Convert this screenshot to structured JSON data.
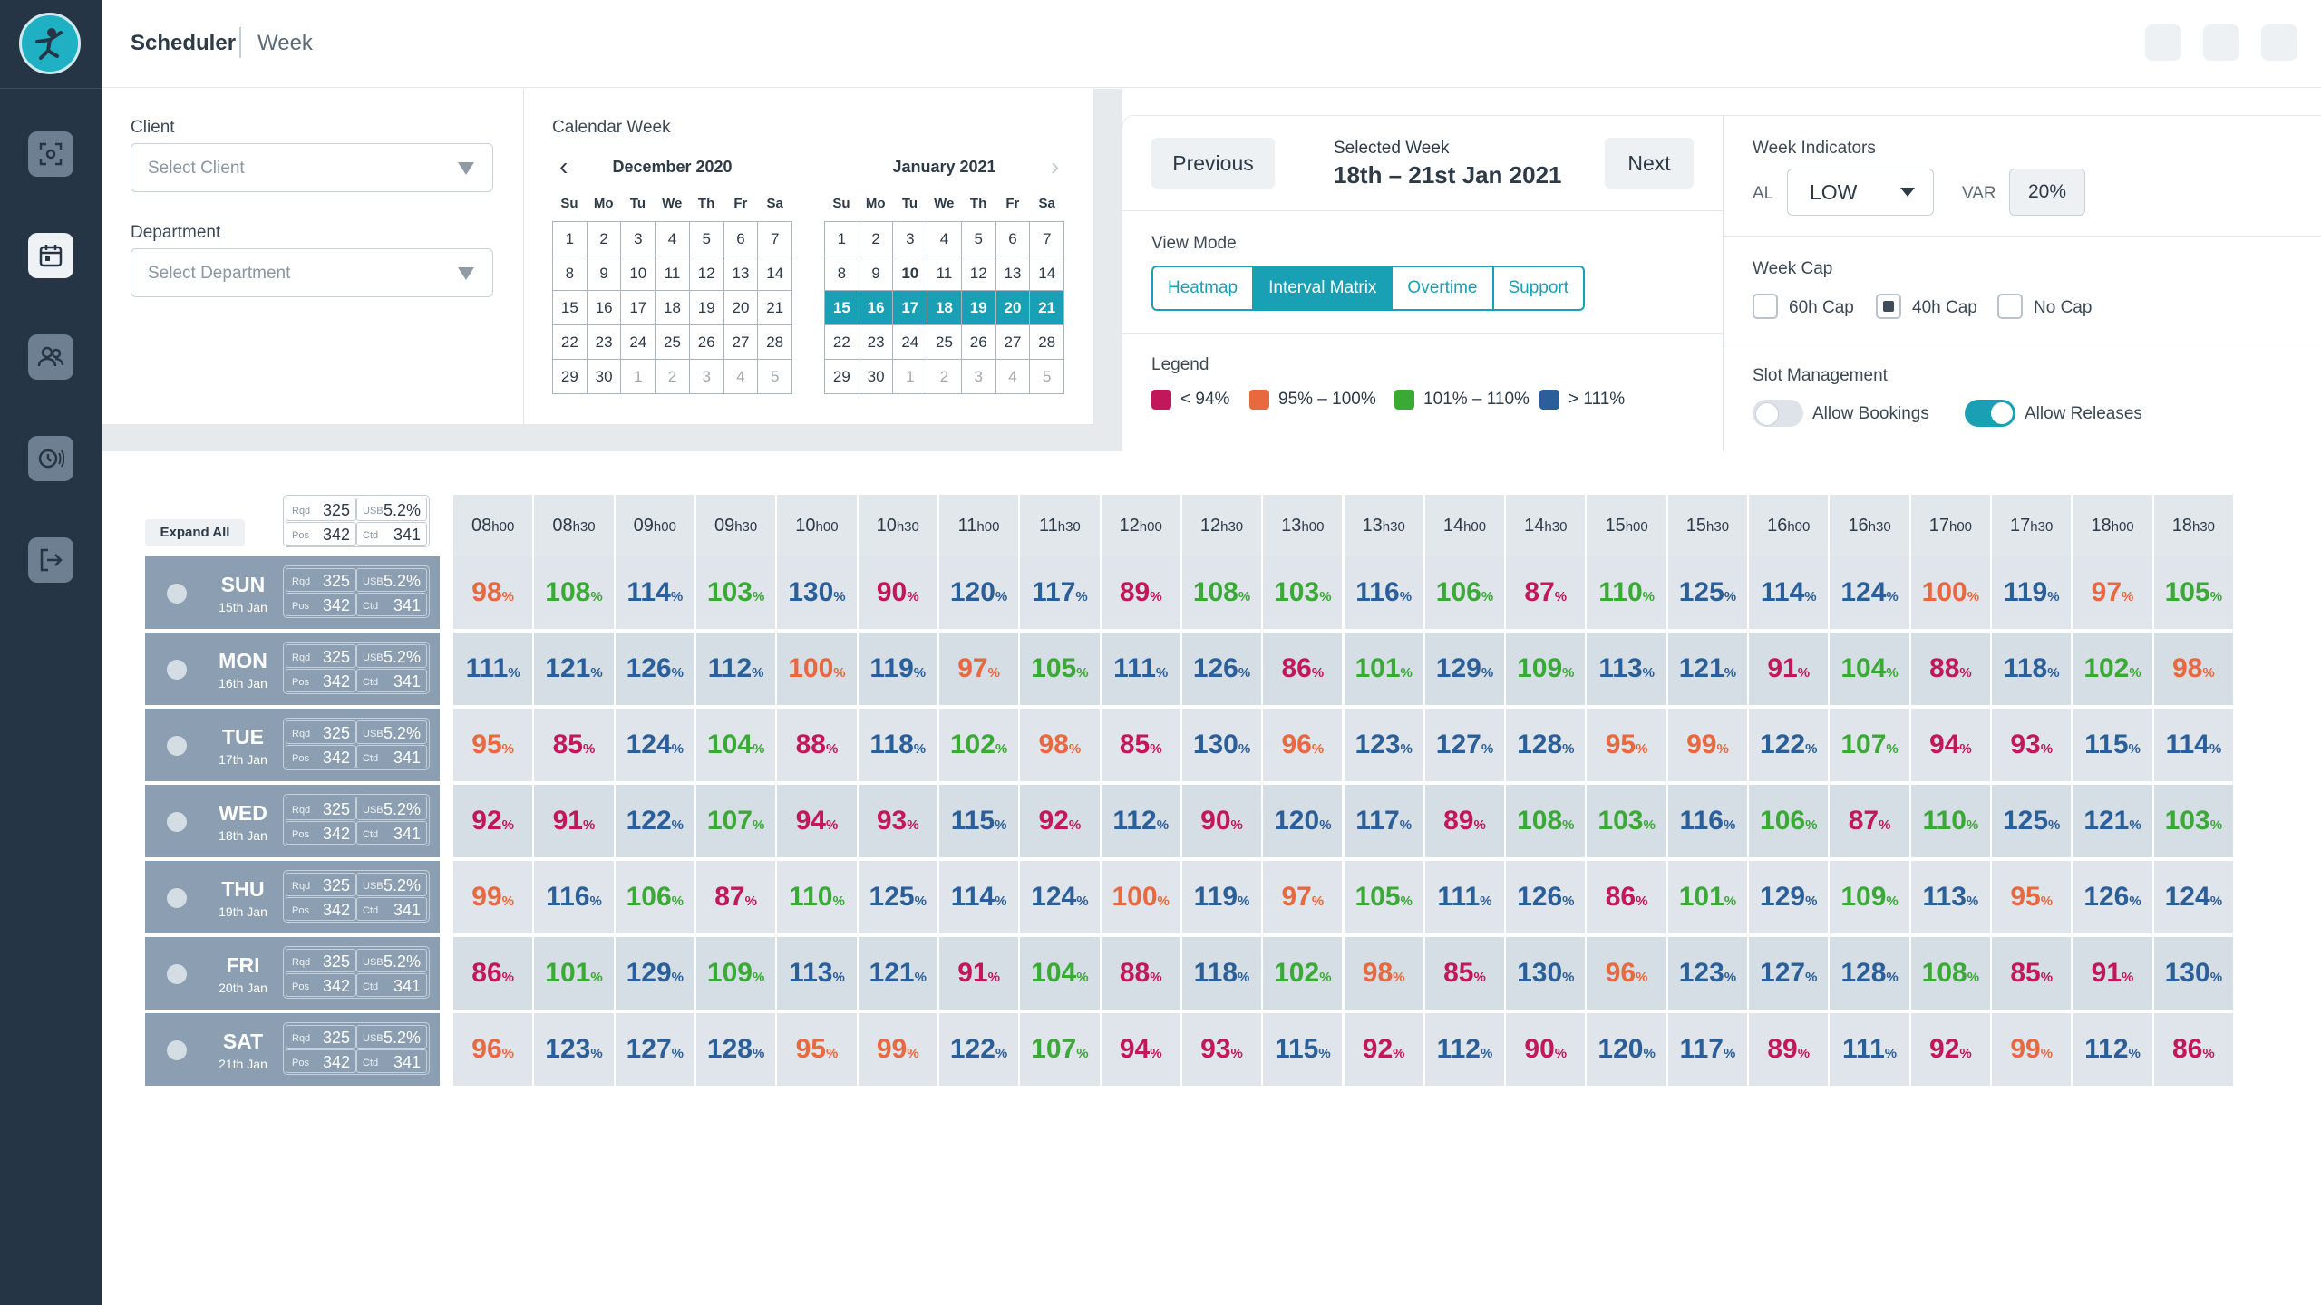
{
  "app": {
    "breadcrumb": [
      "Scheduler",
      "Week"
    ]
  },
  "nav": [
    "scan-icon",
    "calendar-icon",
    "users-icon",
    "clock-broadcast-icon",
    "exit-icon"
  ],
  "filters": {
    "client_label": "Client",
    "client_placeholder": "Select Client",
    "department_label": "Department",
    "department_placeholder": "Select Department",
    "calendar_label": "Calendar Week",
    "calendar_left": {
      "month": "December 2020"
    },
    "calendar_right": {
      "month": "January 2021"
    },
    "weekdays": [
      "Su",
      "Mo",
      "Tu",
      "We",
      "Th",
      "Fr",
      "Sa"
    ]
  },
  "week": {
    "previous_label": "Previous",
    "next_label": "Next",
    "selected_label": "Selected Week",
    "selected_value": "18th – 21st Jan 2021",
    "view_mode_label": "View Mode",
    "view_modes": [
      "Heatmap",
      "Interval Matrix",
      "Overtime",
      "Support"
    ],
    "view_mode_active": "Interval Matrix",
    "legend_label": "Legend",
    "legend": [
      {
        "label": "< 94%",
        "color": "#c2185b"
      },
      {
        "label": "95% – 100%",
        "color": "#e8683f"
      },
      {
        "label": "101% – 110%",
        "color": "#3aa935"
      },
      {
        "label": "> 111%",
        "color": "#2b5f99"
      }
    ]
  },
  "indicators": {
    "title": "Week Indicators",
    "al_label": "AL",
    "al_value": "LOW",
    "var_label": "VAR",
    "var_value": "20%",
    "cap_title": "Week Cap",
    "caps": [
      {
        "label": "60h Cap",
        "checked": false
      },
      {
        "label": "40h Cap",
        "checked": true
      },
      {
        "label": "No Cap",
        "checked": false
      }
    ],
    "slot_title": "Slot Management",
    "allow_bookings_label": "Allow Bookings",
    "allow_bookings": false,
    "allow_releases_label": "Allow Releases",
    "allow_releases": true
  },
  "matrix": {
    "expand_label": "Expand All",
    "summary": {
      "rqd_label": "Rqd",
      "rqd": "325",
      "usb_label": "USB",
      "usb": "5.2%",
      "pos_label": "Pos",
      "pos": "342",
      "ctd_label": "Ctd",
      "ctd": "341"
    },
    "times": [
      "08h00",
      "08h30",
      "09h00",
      "09h30",
      "10h00",
      "10h30",
      "11h00",
      "11h30",
      "12h00",
      "12h30",
      "13h00",
      "13h30",
      "14h00",
      "14h30",
      "15h00",
      "15h30",
      "16h00",
      "16h30",
      "17h00",
      "17h30",
      "18h00",
      "18h30"
    ],
    "rows": [
      {
        "day": "SUN",
        "date": "15th Jan",
        "rqd": "325",
        "usb": "5.2%",
        "pos": "342",
        "ctd": "341",
        "values": [
          98,
          108,
          114,
          103,
          130,
          90,
          120,
          117,
          89,
          108,
          103,
          116,
          106,
          87,
          110,
          125,
          114,
          124,
          100,
          119,
          97,
          105
        ]
      },
      {
        "day": "MON",
        "date": "16th Jan",
        "rqd": "325",
        "usb": "5.2%",
        "pos": "342",
        "ctd": "341",
        "values": [
          111,
          121,
          126,
          112,
          100,
          119,
          97,
          105,
          111,
          126,
          86,
          101,
          129,
          109,
          113,
          121,
          91,
          104,
          88,
          118,
          102,
          98
        ]
      },
      {
        "day": "TUE",
        "date": "17th Jan",
        "rqd": "325",
        "usb": "5.2%",
        "pos": "342",
        "ctd": "341",
        "values": [
          95,
          85,
          124,
          104,
          88,
          118,
          102,
          98,
          85,
          130,
          96,
          123,
          127,
          128,
          95,
          99,
          122,
          107,
          94,
          93,
          115,
          114
        ]
      },
      {
        "day": "WED",
        "date": "18th Jan",
        "rqd": "325",
        "usb": "5.2%",
        "pos": "342",
        "ctd": "341",
        "values": [
          92,
          91,
          122,
          107,
          94,
          93,
          115,
          92,
          112,
          90,
          120,
          117,
          89,
          108,
          103,
          116,
          106,
          87,
          110,
          125,
          121,
          103
        ]
      },
      {
        "day": "THU",
        "date": "19th Jan",
        "rqd": "325",
        "usb": "5.2%",
        "pos": "342",
        "ctd": "341",
        "values": [
          99,
          116,
          106,
          87,
          110,
          125,
          114,
          124,
          100,
          119,
          97,
          105,
          111,
          126,
          86,
          101,
          129,
          109,
          113,
          95,
          126,
          124
        ]
      },
      {
        "day": "FRI",
        "date": "20th Jan",
        "rqd": "325",
        "usb": "5.2%",
        "pos": "342",
        "ctd": "341",
        "values": [
          86,
          101,
          129,
          109,
          113,
          121,
          91,
          104,
          88,
          118,
          102,
          98,
          85,
          130,
          96,
          123,
          127,
          128,
          108,
          85,
          91,
          130
        ]
      },
      {
        "day": "SAT",
        "date": "21th Jan",
        "rqd": "325",
        "usb": "5.2%",
        "pos": "342",
        "ctd": "341",
        "values": [
          96,
          123,
          127,
          128,
          95,
          99,
          122,
          107,
          94,
          93,
          115,
          92,
          112,
          90,
          120,
          117,
          89,
          111,
          92,
          99,
          112,
          86
        ]
      }
    ]
  }
}
